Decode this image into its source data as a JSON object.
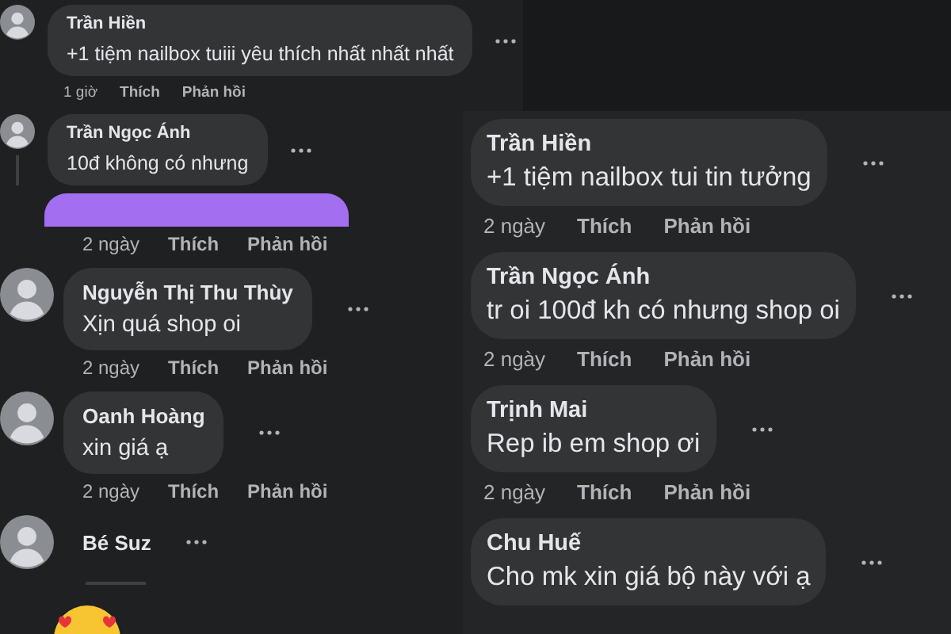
{
  "panels": [
    {
      "comments": [
        {
          "kind": "bubble",
          "avatar": true,
          "name": "Trần Hiền",
          "text": "+1 tiệm nailbox tuiii yêu thích nhất nhất nhất",
          "time": "1 giờ",
          "like": "Thích",
          "reply": "Phản hồi"
        },
        {
          "kind": "bubble",
          "avatar": true,
          "thread_line": true,
          "name": "Trần Ngọc Ánh",
          "text": "10đ không có nhưng"
        }
      ]
    },
    {
      "comments": [
        {
          "kind": "attachment",
          "time": "2 ngày",
          "like": "Thích",
          "reply": "Phản hồi"
        },
        {
          "kind": "bubble",
          "avatar": true,
          "name": "Nguyễn Thị Thu Thùy",
          "text": "Xịn quá shop oi",
          "time": "2 ngày",
          "like": "Thích",
          "reply": "Phản hồi"
        },
        {
          "kind": "bubble",
          "avatar": true,
          "name": "Oanh Hoàng",
          "text": "xin giá ạ",
          "time": "2 ngày",
          "like": "Thích",
          "reply": "Phản hồi"
        },
        {
          "kind": "name_only",
          "avatar": true,
          "name": "Bé Suz",
          "sticker": true
        }
      ]
    },
    {
      "comments": [
        {
          "kind": "bubble",
          "name": "Trần Hiền",
          "text": "+1 tiệm nailbox tui tin tưởng",
          "time": "2 ngày",
          "like": "Thích",
          "reply": "Phản hồi"
        },
        {
          "kind": "bubble",
          "name": "Trần Ngọc Ánh",
          "text": "tr oi 100đ kh có nhưng shop oi",
          "time": "2 ngày",
          "like": "Thích",
          "reply": "Phản hồi"
        },
        {
          "kind": "bubble",
          "name": "Trịnh Mai",
          "text": "Rep ib em shop ơi",
          "time": "2 ngày",
          "like": "Thích",
          "reply": "Phản hồi"
        },
        {
          "kind": "bubble",
          "name": "Chu Huế",
          "text": "Cho mk xin giá bộ này với ạ"
        }
      ]
    }
  ]
}
